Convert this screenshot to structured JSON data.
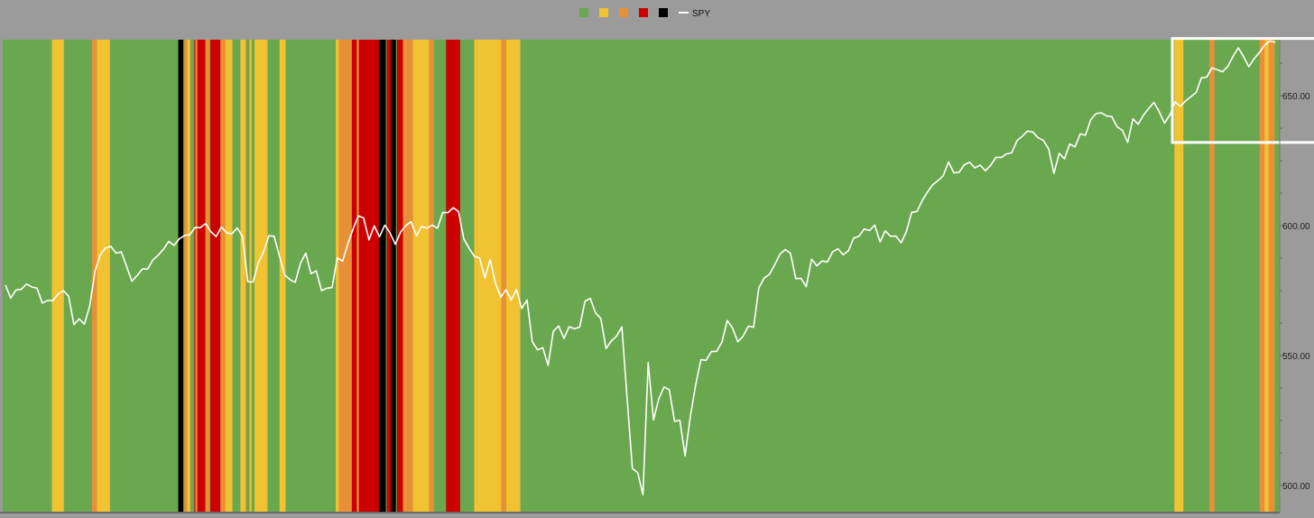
{
  "chart_data": {
    "type": "line",
    "title": "",
    "xlabel": "",
    "ylabel": "",
    "ylim": [
      496,
      671
    ],
    "y_ticks": [
      500,
      550,
      600,
      650
    ],
    "y_tick_labels": [
      "500.00",
      "550.00",
      "600.00",
      "650.00"
    ],
    "grid": false,
    "legend_position": "top-center",
    "legend": [
      {
        "label": "",
        "color": "#6aa84f",
        "marker": "square"
      },
      {
        "label": "",
        "color": "#f1c232",
        "marker": "square"
      },
      {
        "label": "",
        "color": "#e69138",
        "marker": "square"
      },
      {
        "label": "",
        "color": "#cc0000",
        "marker": "square"
      },
      {
        "label": "",
        "color": "#000000",
        "marker": "square"
      },
      {
        "label": "SPY",
        "color": "#ffffff",
        "marker": "line"
      }
    ],
    "regime_colors": {
      "g": "#6aa84f",
      "y": "#f1c232",
      "o": "#e69138",
      "r": "#cc0000",
      "k": "#000000"
    },
    "regime_sequence": "gggggggggggggggggggggggggggggggggggggggggggggggggyyyyyyyyyyyyggggggggggggggggggggggggggggoooooyyyyyyyyyyyyyggggggggggggggggggggggggggggggggggggggggggggggggggggggggggggggggggggkkkkkgoooyyyggggroorrrrrrrroooogrrrrrrrrrroooooyyyyyyyggggggggyyyyyogggyygggyyyyyyyyyyyyyggggggggggggyyyyyyggggggggggggggggggggggggggggggggggggggggggggggggggyyyooooooooooooorrrrroorrrrrrrrrrrrrrrrrrrrkkkkkkkgrrrrkkkkkgrrrrrrooooooooooyyyyyyyyyyyyyyyyoooooggggggggggggrrrrrrrrrrrrrrggggggggggggggyyyyyyyyyyyyyyyyyyyyyyyyyyyoooooyyyyyyyyyyyyyyggggggggggggggggggggggggggggggggggggggggggggggggggggggggggggggggggggggggggggggggggggggggggggggggggggggggggggggggggggggggggggggggggggggggggggggggggggggggggggggggggggggggggggggggggggggggggggggggggggggggggggggggggggggggggggggggggggggggggggggggggggggggggggggggggggggggggggggggggggggggggggggggggggggggggggggggggggggggggggggggggggggggggggggggggggggggggggggggggggggggggggggggggggggggggggggggggggggggggggggggggggggggggggggggggggggggggggggggggggggggggggggggggggggggggggggggggggggggggggggggggggggggggggggggggggggggggggggggggggggggggggggggggggggggggggggggggggggggggggggggggggggggggggggggggggggggggggggggggggggggggggggggggggggggggggggggggggggggggggggggggggggggggggyyyyyyyyyggggggggggggggggggggggggggooooogggggggggggggggggggggggggggggggggggggggggggggoooooyyyyooooooggggg",
    "series": [
      {
        "name": "SPY",
        "color": "#ffffff",
        "values": [
          577.1,
          572.1,
          575.2,
          575.5,
          577.5,
          576.4,
          575.9,
          570.2,
          571.2,
          571.2,
          573.6,
          575.0,
          572.8,
          561.9,
          564.1,
          562.1,
          569.0,
          582.5,
          588.7,
          591.4,
          592.0,
          589.4,
          589.9,
          584.3,
          578.6,
          580.8,
          583.3,
          583.3,
          586.8,
          588.6,
          590.9,
          593.9,
          592.4,
          594.9,
          596.2,
          596.5,
          599.3,
          599.2,
          600.8,
          597.6,
          595.8,
          599.5,
          597.2,
          596.9,
          599.1,
          595.8,
          578.4,
          578.3,
          585.7,
          589.9,
          596.1,
          595.9,
          588.4,
          581.1,
          579.2,
          578.2,
          585.5,
          589.4,
          581.5,
          582.6,
          575.0,
          575.9,
          576.2,
          587.6,
          586.3,
          593.0,
          598.8,
          603.8,
          602.9,
          594.5,
          599.9,
          595.7,
          600.2,
          597.2,
          592.8,
          597.5,
          600.0,
          601.5,
          596.0,
          599.7,
          599.0,
          600.2,
          599.0,
          605.0,
          605.0,
          606.9,
          605.4,
          594.9,
          591.3,
          588.2,
          587.5,
          579.9,
          586.9,
          577.9,
          572.5,
          575.3,
          571.4,
          575.4,
          568.1,
          571.4,
          555.3,
          552.2,
          553.0,
          546.2,
          559.4,
          561.4,
          556.6,
          561.1,
          560.3,
          561.0,
          570.9,
          572.0,
          566.4,
          564.3,
          552.7,
          555.6,
          557.5,
          561.0,
          533.5,
          506.5,
          505.0,
          496.5,
          547.3,
          525.2,
          533.3,
          537.9,
          536.9,
          524.7,
          525.1,
          511.4,
          526.6,
          538.6,
          548.4,
          548.2,
          551.6,
          551.6,
          555.2,
          563.5,
          560.6,
          555.3,
          557.4,
          561.3,
          560.9,
          576.1,
          579.8,
          581.2,
          584.9,
          589.0,
          590.8,
          589.4,
          579.6,
          579.7,
          576.5,
          587.1,
          584.5,
          586.4,
          586.0,
          589.9,
          591.1,
          588.8,
          590.3,
          595.2,
          595.9,
          598.7,
          598.1,
          600.2,
          593.7,
          598.0,
          595.9,
          596.0,
          593.4,
          597.7,
          605.1,
          605.4,
          609.6,
          612.9,
          615.7,
          617.3,
          619.2,
          624.5,
          620.3,
          620.5,
          623.4,
          624.4,
          622.2,
          623.3,
          621.1,
          623.2,
          626.3,
          626.2,
          627.6,
          628.0,
          632.7,
          634.4,
          636.4,
          636.0,
          633.8,
          632.8,
          629.5,
          620.1,
          627.8,
          625.7,
          631.4,
          630.3,
          635.3,
          634.8,
          640.8,
          643.1,
          643.4,
          642.2,
          641.9,
          638.0,
          636.7,
          632.0,
          641.1,
          639.0,
          642.5,
          645.1,
          647.4,
          643.8,
          639.4,
          642.6,
          647.6,
          645.9,
          648.0,
          649.6,
          651.2,
          656.9,
          657.1,
          660.7,
          660.0,
          659.2,
          661.2,
          665.1,
          668.4,
          665.0,
          661.1,
          664.2,
          666.6,
          669.4,
          671.0,
          670.5
        ]
      }
    ],
    "annotations": [
      {
        "type": "rectangle",
        "color": "#ffffff",
        "series_index_range": [
          222,
          253
        ],
        "y_range": [
          632,
          672
        ]
      }
    ]
  }
}
